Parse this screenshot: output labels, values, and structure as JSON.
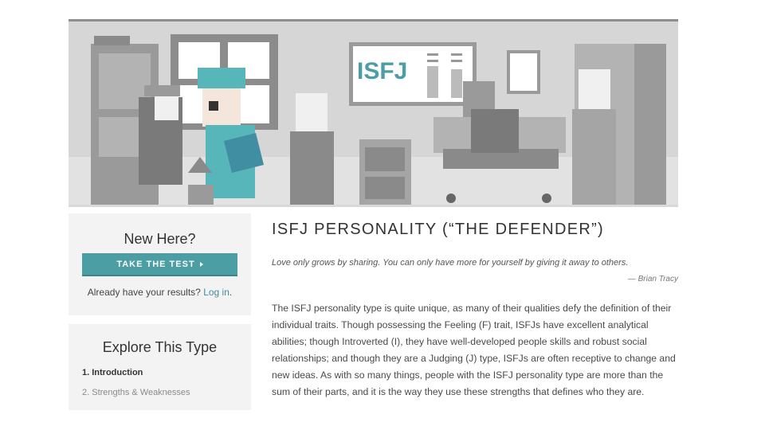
{
  "hero": {
    "board_text": "ISFJ",
    "colors": {
      "accent": "#4a9ea4",
      "teal": "#56b6ba",
      "gray": "#d9d9d9"
    }
  },
  "sidebar": {
    "new_here": {
      "heading": "New Here?",
      "button_label": "TAKE THE TEST",
      "already_text": "Already have your results?",
      "login_link": "Log in",
      "period": "."
    },
    "explore": {
      "heading": "Explore This Type",
      "items": [
        {
          "label": "1. Introduction",
          "active": true
        },
        {
          "label": "2. Strengths & Weaknesses",
          "active": false
        }
      ]
    }
  },
  "main": {
    "title": "ISFJ PERSONALITY (“THE DEFENDER”)",
    "quote": "Love only grows by sharing. You can only have more for yourself by giving it away to others.",
    "quote_author": "— Brian Tracy",
    "body": "The ISFJ personality type is quite unique, as many of their qualities defy the definition of their individual traits. Though possessing the Feeling (F) trait, ISFJs have excellent analytical abilities; though Introverted (I), they have well-developed people skills and robust social relationships; and though they are a Judging (J) type, ISFJs are often receptive to change and new ideas. As with so many things, people with the ISFJ personality type are more than the sum of their parts, and it is the way they use these strengths that defines who they are."
  }
}
